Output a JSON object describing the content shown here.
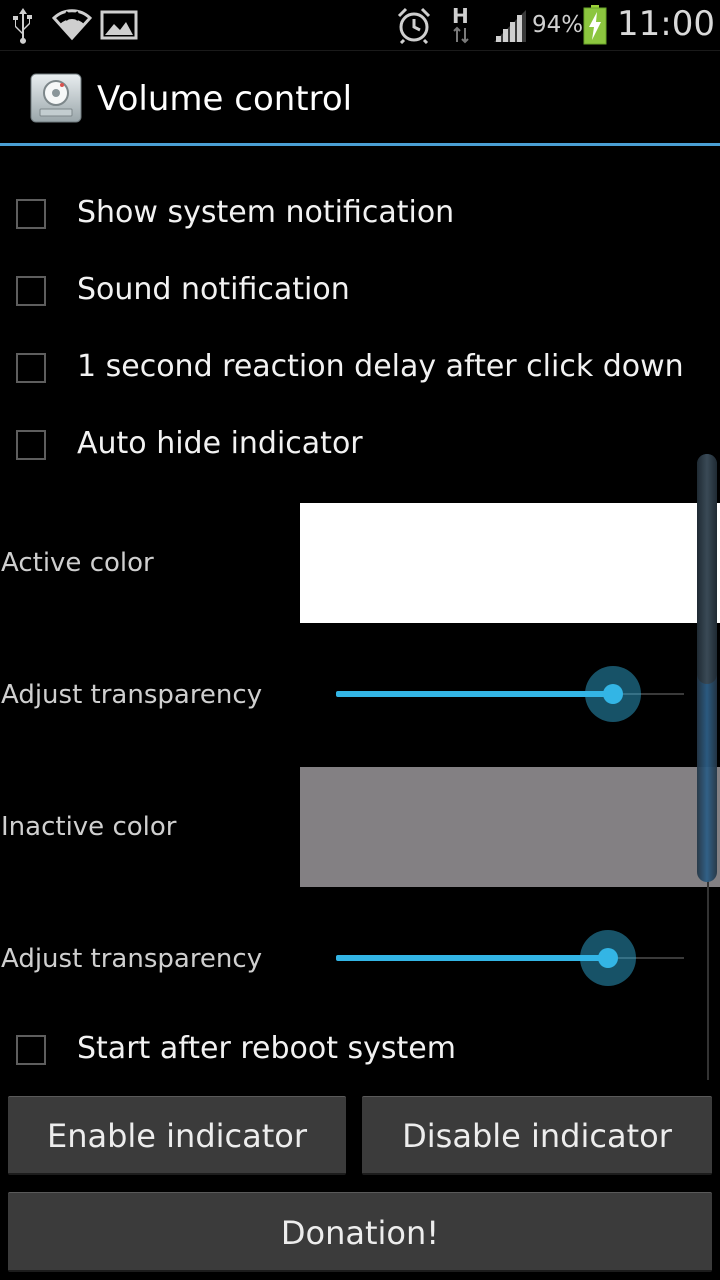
{
  "status_bar": {
    "battery_percent": "94%",
    "time": "11:00",
    "network_type": "H",
    "icons": [
      "usb-icon",
      "wifi-icon",
      "image-icon",
      "alarm-icon",
      "data-arrows-icon",
      "signal-icon",
      "battery-charging-icon"
    ]
  },
  "action_bar": {
    "title": "Volume control",
    "icon": "volume-control-app-icon",
    "accent_color": "#4a9fd4"
  },
  "settings": {
    "show_system_notification": {
      "label": "Show system notification",
      "checked": false
    },
    "sound_notification": {
      "label": "Sound notification",
      "checked": false
    },
    "reaction_delay": {
      "label": "1 second reaction delay after click down",
      "checked": false
    },
    "auto_hide_indicator": {
      "label": "Auto hide indicator",
      "checked": false
    },
    "active_color": {
      "label": "Active color",
      "color": "#ffffff"
    },
    "active_transparency": {
      "label": "Adjust transparency",
      "value_percent": 79.6
    },
    "inactive_color": {
      "label": "Inactive color",
      "color": "#838083"
    },
    "inactive_transparency": {
      "label": "Adjust transparency",
      "value_percent": 78.2
    },
    "start_after_reboot": {
      "label": "Start after reboot system",
      "checked": false
    }
  },
  "buttons": {
    "enable": "Enable indicator",
    "disable": "Disable indicator",
    "donation": "Donation!"
  },
  "colors": {
    "slider_accent": "#33b5e5",
    "button_bg": "#3b3b3b"
  }
}
